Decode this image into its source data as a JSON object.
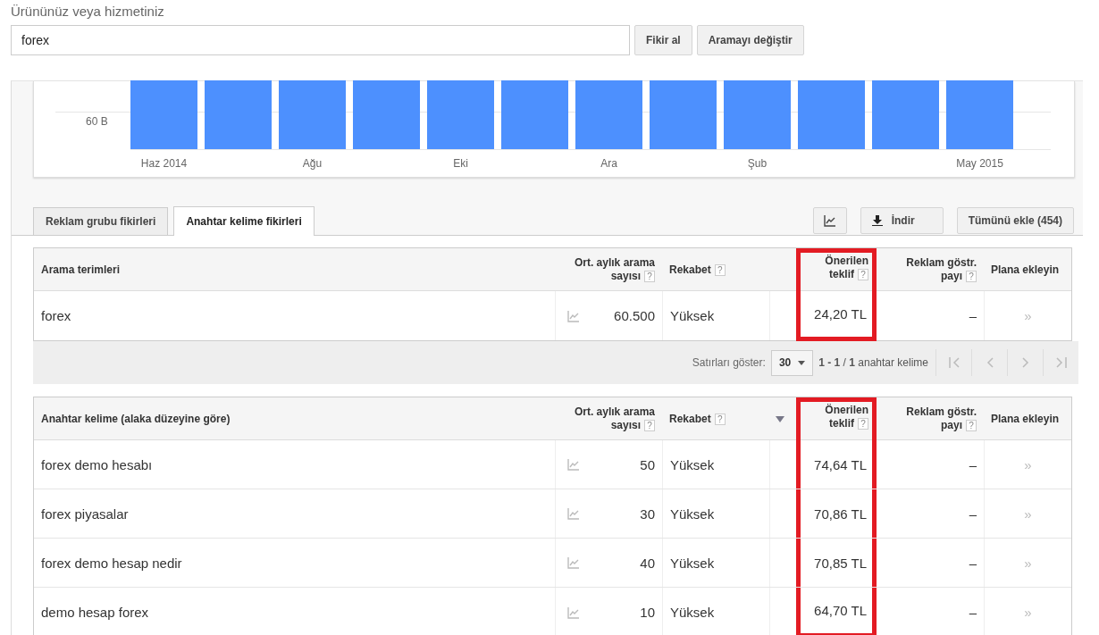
{
  "search": {
    "label": "Ürününüz veya hizmetiniz",
    "value": "forex"
  },
  "search_buttons": [
    "Fikir al",
    "Aramayı değiştir"
  ],
  "trend_chart": {
    "y_tick_label": "60 B",
    "months": [
      {
        "kind": "labeled",
        "label": "Haz 2014"
      },
      {
        "kind": "plain"
      },
      {
        "kind": "labeled",
        "label": "Ağu"
      },
      {
        "kind": "plain"
      },
      {
        "kind": "labeled",
        "label": "Eki"
      },
      {
        "kind": "plain"
      },
      {
        "kind": "labeled",
        "label": "Ara"
      },
      {
        "kind": "plain"
      },
      {
        "kind": "labeled",
        "label": "Şub"
      },
      {
        "kind": "plain"
      },
      {
        "kind": "plain"
      },
      {
        "kind": "labeled",
        "label": "May 2015"
      }
    ]
  },
  "tabs": [
    {
      "label": "Reklam grubu fikirleri",
      "selected": false
    },
    {
      "label": "Anahtar kelime fikirleri",
      "selected": true
    }
  ],
  "toolbar": {
    "download": "İndir",
    "add_all": "Tümünü ekle (454)"
  },
  "tables": [
    {
      "columns": [
        {
          "label": "Arama terimleri",
          "kind": "term",
          "highlighted": false,
          "sorted": false
        },
        {
          "label": "Ort. aylık arama sayısı",
          "help": "?",
          "kind": "number",
          "highlighted": false,
          "sorted": false
        },
        {
          "label": "Rekabet",
          "help": "?",
          "kind": "text",
          "highlighted": false,
          "sorted": false
        },
        {
          "label": "Önerilen teklif",
          "help": "?",
          "kind": "number",
          "highlighted": true,
          "sorted": false
        },
        {
          "label": "Reklam göstr. payı",
          "help": "?",
          "kind": "number",
          "highlighted": false,
          "sorted": false
        },
        {
          "label": "Plana ekleyin",
          "kind": "text",
          "highlighted": false,
          "sorted": false
        }
      ],
      "rows": [
        {
          "term": "forex",
          "searches": "60.500",
          "competition": "Yüksek",
          "bid": "24,20 TL",
          "share": "–",
          "add": "»"
        }
      ],
      "pager": {
        "label": "Satırları göster:",
        "rows_value": "30",
        "range": "**1 - 1** / **1** anahtar kelime"
      }
    },
    {
      "columns": [
        {
          "label": "Anahtar kelime (alaka düzeyine göre)",
          "kind": "term",
          "highlighted": false,
          "sorted": false
        },
        {
          "label": "Ort. aylık arama sayısı",
          "help": "?",
          "kind": "number",
          "highlighted": false,
          "sorted": false
        },
        {
          "label": "Rekabet",
          "help": "?",
          "kind": "text",
          "highlighted": false,
          "sorted": false
        },
        {
          "label": "Önerilen teklif",
          "help": "?",
          "kind": "number",
          "highlighted": true,
          "sorted": true
        },
        {
          "label": "Reklam göstr. payı",
          "help": "?",
          "kind": "number",
          "highlighted": false,
          "sorted": false
        },
        {
          "label": "Plana ekleyin",
          "kind": "text",
          "highlighted": false,
          "sorted": false
        }
      ],
      "rows": [
        {
          "term": "forex demo hesabı",
          "searches": "50",
          "competition": "Yüksek",
          "bid": "74,64 TL",
          "share": "–",
          "add": "»"
        },
        {
          "term": "forex piyasalar",
          "searches": "30",
          "competition": "Yüksek",
          "bid": "70,86 TL",
          "share": "–",
          "add": "»"
        },
        {
          "term": "forex demo hesap nedir",
          "searches": "40",
          "competition": "Yüksek",
          "bid": "70,85 TL",
          "share": "–",
          "add": "»"
        },
        {
          "term": "demo hesap forex",
          "searches": "10",
          "competition": "Yüksek",
          "bid": "64,70 TL",
          "share": "–",
          "add": "»"
        }
      ]
    }
  ]
}
